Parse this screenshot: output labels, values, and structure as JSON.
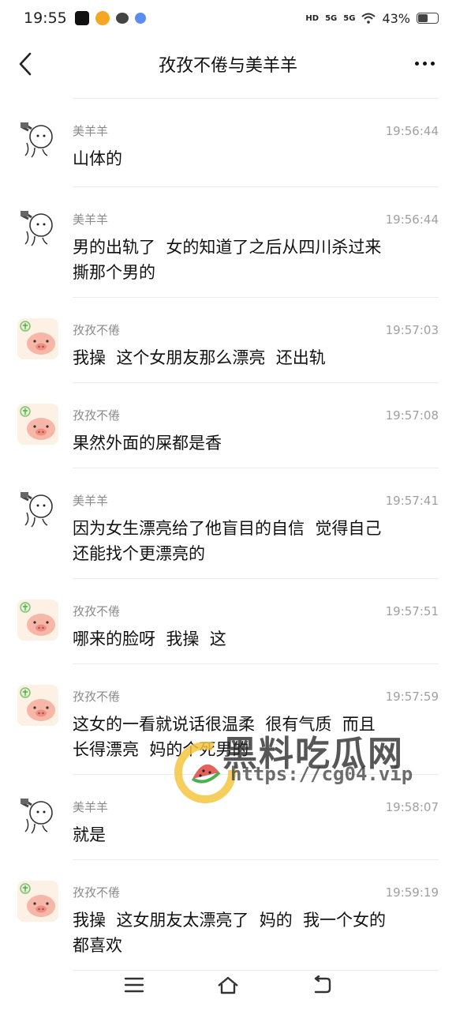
{
  "status_bar": {
    "time": "19:55",
    "network_hd": "HD",
    "sim1": "5G",
    "sim2": "5G",
    "battery": "43%"
  },
  "header": {
    "title": "孜孜不倦与美羊羊"
  },
  "messages": [
    {
      "sender": "美羊羊",
      "time": "19:56:44",
      "avatar": "sheep-avatar",
      "lines": [
        "山体的"
      ]
    },
    {
      "sender": "美羊羊",
      "time": "19:56:44",
      "avatar": "sheep-avatar",
      "lines": [
        "男的出轨了  女的知道了之后从四川杀过来",
        "撕那个男的"
      ]
    },
    {
      "sender": "孜孜不倦",
      "time": "19:57:03",
      "avatar": "pig-avatar",
      "lines": [
        "我操  这个女朋友那么漂亮  还出轨"
      ]
    },
    {
      "sender": "孜孜不倦",
      "time": "19:57:08",
      "avatar": "pig-avatar",
      "lines": [
        "果然外面的屎都是香"
      ]
    },
    {
      "sender": "美羊羊",
      "time": "19:57:41",
      "avatar": "sheep-avatar",
      "lines": [
        "因为女生漂亮给了他盲目的自信  觉得自己",
        "还能找个更漂亮的"
      ]
    },
    {
      "sender": "孜孜不倦",
      "time": "19:57:51",
      "avatar": "pig-avatar",
      "lines": [
        "哪来的脸呀  我操  这"
      ]
    },
    {
      "sender": "孜孜不倦",
      "time": "19:57:59",
      "avatar": "pig-avatar",
      "lines": [
        "这女的一看就说话很温柔  很有气质  而且",
        "长得漂亮  妈的个死男的"
      ]
    },
    {
      "sender": "美羊羊",
      "time": "19:58:07",
      "avatar": "sheep-avatar",
      "lines": [
        "就是"
      ]
    },
    {
      "sender": "孜孜不倦",
      "time": "19:59:19",
      "avatar": "pig-avatar",
      "lines": [
        "我操  这女朋友太漂亮了  妈的  我一个女的",
        "都喜欢"
      ]
    }
  ],
  "watermark": {
    "title": "黑料吃瓜网",
    "url": "https://cg04.vip"
  },
  "colors": {
    "accent_yellow": "#f5c542",
    "watermelon_red": "#e0524a",
    "watermelon_green": "#4caf50"
  }
}
